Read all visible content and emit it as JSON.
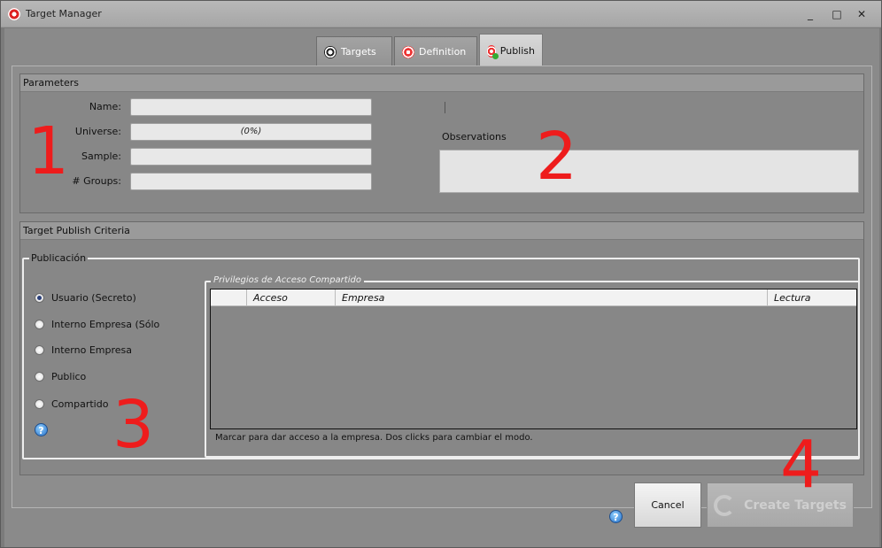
{
  "window": {
    "title": "Target Manager",
    "controls": {
      "minimize": "_",
      "maximize": "□",
      "close": "✕"
    }
  },
  "tabs": [
    {
      "label": "Targets",
      "icon": "target-dart-icon",
      "active": false
    },
    {
      "label": "Definition",
      "icon": "target-icon",
      "active": false
    },
    {
      "label": "Publish",
      "icon": "target-add-icon",
      "active": true
    }
  ],
  "parameters": {
    "header": "Parameters",
    "fields": [
      {
        "label": "Name:",
        "value": ""
      },
      {
        "label": "Universe:",
        "value": "(0%)"
      },
      {
        "label": "Sample:",
        "value": ""
      },
      {
        "label": "# Groups:",
        "value": ""
      }
    ],
    "observations_label": "Observations",
    "observations_value": ""
  },
  "criteria": {
    "header": "Target Publish Criteria",
    "publication": {
      "legend": "Publicación",
      "options": [
        {
          "label": "Usuario (Secreto)",
          "checked": true
        },
        {
          "label": "Interno Empresa (Sólo",
          "checked": false
        },
        {
          "label": "Interno Empresa",
          "checked": false
        },
        {
          "label": "Publico",
          "checked": false
        },
        {
          "label": "Compartido",
          "checked": false
        }
      ],
      "help": "?"
    },
    "privileges": {
      "legend": "Privilegios de Acceso Compartido",
      "columns": [
        "",
        "Acceso",
        "Empresa",
        "Lectura"
      ],
      "rows": [],
      "note": "Marcar para dar acceso a la empresa. Dos clicks para cambiar el modo."
    }
  },
  "buttons": {
    "help": "?",
    "cancel": "Cancel",
    "create": "Create Targets"
  },
  "annotations": [
    "1",
    "2",
    "3",
    "4"
  ],
  "colors": {
    "annotation": "#ee1c1c",
    "accent": "#e33333"
  }
}
